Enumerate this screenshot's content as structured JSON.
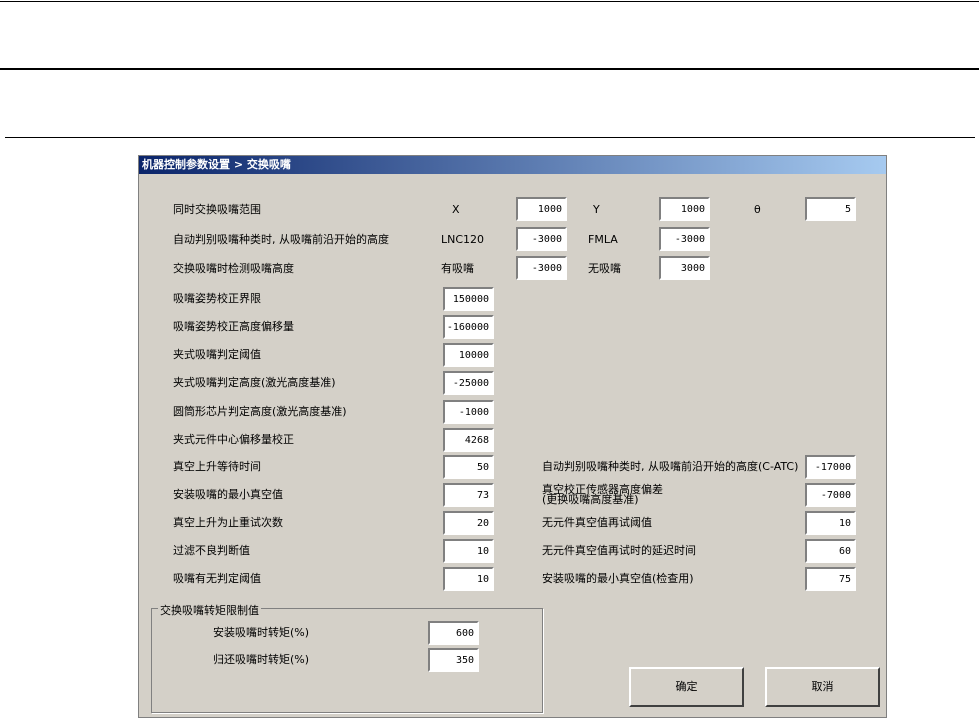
{
  "title": "机器控制参数设置 > 交换吸嘴",
  "top": {
    "label": "同时交换吸嘴范围",
    "cols": [
      {
        "axis": "X",
        "value": "1000"
      },
      {
        "axis": "Y",
        "value": "1000"
      },
      {
        "axis": "θ",
        "value": "5"
      }
    ]
  },
  "row2": {
    "label": "自动判别吸嘴种类时, 从吸嘴前沿开始的高度",
    "a_label": "LNC120",
    "a_value": "-3000",
    "b_label": "FMLA",
    "b_value": "-3000"
  },
  "row3": {
    "label": "交换吸嘴时检测吸嘴高度",
    "a_label": "有吸嘴",
    "a_value": "-3000",
    "b_label": "无吸嘴",
    "b_value": "3000"
  },
  "left": [
    {
      "label": "吸嘴姿势校正界限",
      "value": "150000"
    },
    {
      "label": "吸嘴姿势校正高度偏移量",
      "value": "-160000"
    },
    {
      "label": "夹式吸嘴判定阈值",
      "value": "10000"
    },
    {
      "label": "夹式吸嘴判定高度(激光高度基准)",
      "value": "-25000"
    },
    {
      "label": "圆筒形芯片判定高度(激光高度基准)",
      "value": "-1000"
    },
    {
      "label": "夹式元件中心偏移量校正",
      "value": "4268"
    },
    {
      "label": "真空上升等待时间",
      "value": "50"
    },
    {
      "label": "安装吸嘴的最小真空值",
      "value": "73"
    },
    {
      "label": "真空上升为止重试次数",
      "value": "20"
    },
    {
      "label": "过滤不良判断值",
      "value": "10"
    },
    {
      "label": "吸嘴有无判定阈值",
      "value": "10"
    }
  ],
  "right": [
    {
      "label": "自动判别吸嘴种类时, 从吸嘴前沿开始的高度(C-ATC)",
      "value": "-17000"
    },
    {
      "label": "真空校正传感器高度偏差",
      "label2": "(更换吸嘴高度基准)",
      "value": "-7000"
    },
    {
      "label": "无元件真空值再试阈值",
      "value": "10"
    },
    {
      "label": "无元件真空值再试时的延迟时间",
      "value": "60"
    },
    {
      "label": "安装吸嘴的最小真空值(检查用)",
      "value": "75"
    }
  ],
  "group": {
    "title": "交换吸嘴转矩限制值",
    "rows": [
      {
        "label": "安装吸嘴时转矩(%)",
        "value": "600"
      },
      {
        "label": "归还吸嘴时转矩(%)",
        "value": "350"
      }
    ]
  },
  "buttons": {
    "ok": "确定",
    "cancel": "取消"
  }
}
